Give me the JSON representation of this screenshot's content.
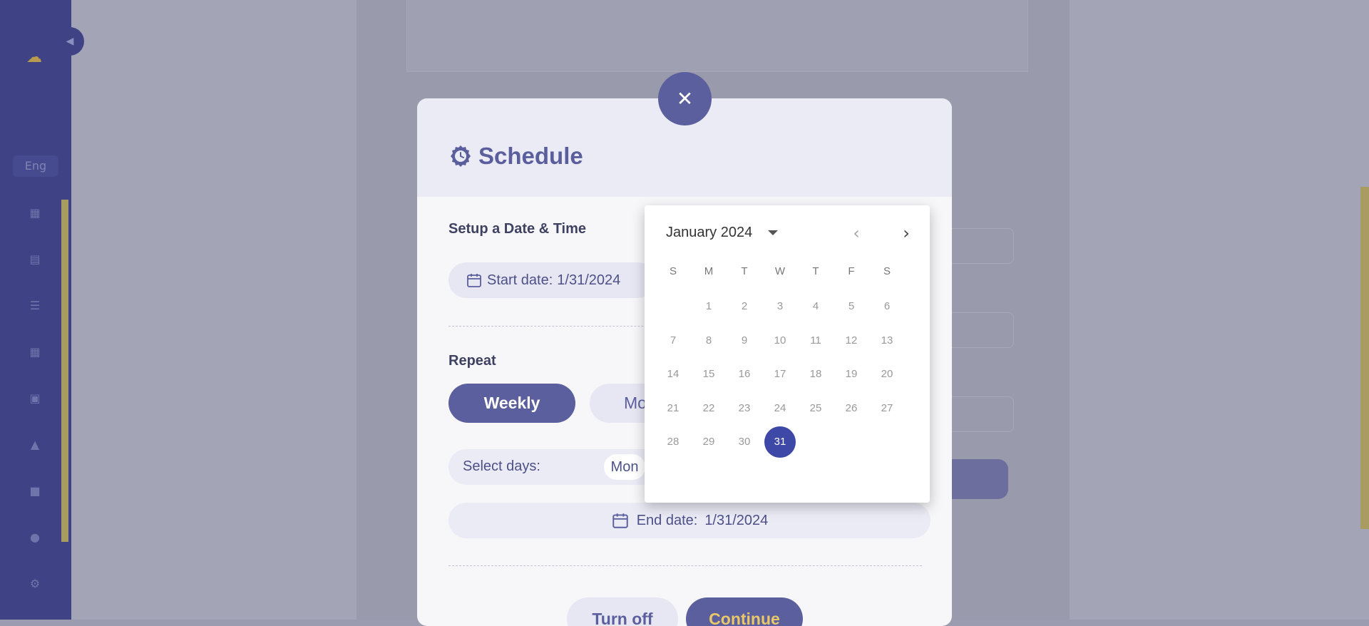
{
  "sidebar": {
    "nav_label": "Eng"
  },
  "modal": {
    "title": "Schedule",
    "close_icon": "close-icon",
    "title_icon": "clock-badge-icon",
    "date_time_section": {
      "label": "Setup a Date & Time",
      "start_date_label": "Start date:",
      "start_date_value": "1/31/2024"
    },
    "repeat_section": {
      "label": "Repeat",
      "weekly_label": "Weekly",
      "monthly_label": "Mo"
    },
    "select_days": {
      "label": "Select days:",
      "chip_mon": "Mon"
    },
    "end_date": {
      "label": "End date:",
      "value": "1/31/2024"
    },
    "footer": {
      "turn_off_label": "Turn off",
      "continue_label": "Continue"
    },
    "colors": {
      "accent": "#5b5f9d",
      "continue_text": "#e9c86a"
    }
  },
  "date_picker": {
    "month_label": "January 2024",
    "weekday_headers": [
      "S",
      "M",
      "T",
      "W",
      "T",
      "F",
      "S"
    ],
    "selected_day": "31",
    "weeks": [
      [
        "",
        "1",
        "2",
        "3",
        "4",
        "5",
        "6"
      ],
      [
        "7",
        "8",
        "9",
        "10",
        "11",
        "12",
        "13"
      ],
      [
        "14",
        "15",
        "16",
        "17",
        "18",
        "19",
        "20"
      ],
      [
        "21",
        "22",
        "23",
        "24",
        "25",
        "26",
        "27"
      ],
      [
        "28",
        "29",
        "30",
        "31",
        "",
        "",
        ""
      ]
    ],
    "selected_color": "#3e48a6"
  }
}
